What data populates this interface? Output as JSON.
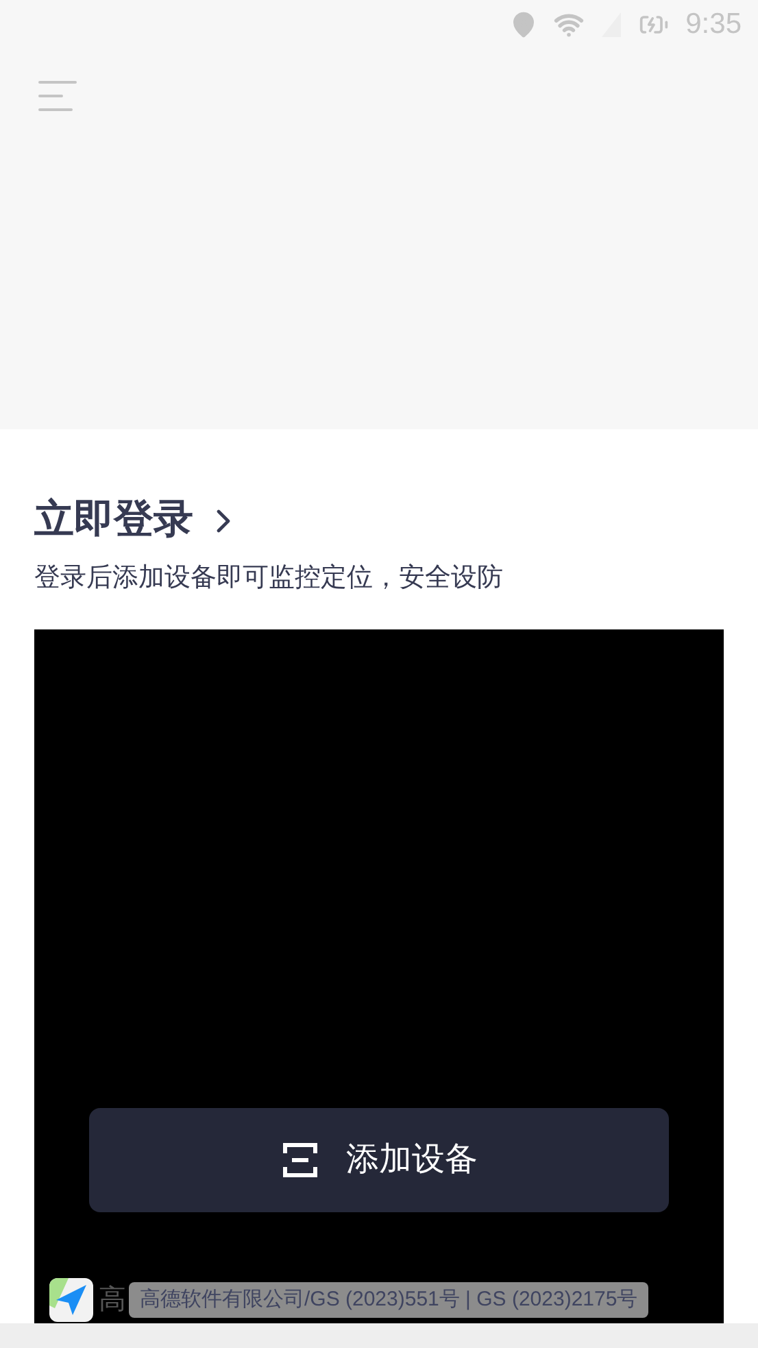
{
  "status_bar": {
    "time": "9:35"
  },
  "login": {
    "title": "立即登录",
    "subtitle": "登录后添加设备即可监控定位，安全设防"
  },
  "map": {
    "add_button": "添加设备",
    "logo_text": "高",
    "attribution": "高德软件有限公司/GS (2023)551号 | GS (2023)2175号"
  }
}
